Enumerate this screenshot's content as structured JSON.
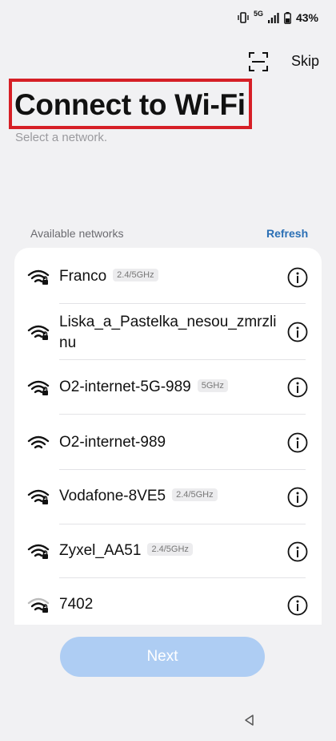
{
  "status_bar": {
    "network_label": "5G",
    "battery": "43%"
  },
  "header": {
    "skip_label": "Skip",
    "scan_icon": "qr-scan-icon",
    "title": "Connect to Wi-Fi",
    "subtitle": "Select a network."
  },
  "networks_section": {
    "label": "Available networks",
    "refresh_label": "Refresh",
    "items": [
      {
        "name": "Franco",
        "band": "2.4/5GHz",
        "secured": true
      },
      {
        "name": "Liska_a_Pastelka_nesou_zmrzlinu",
        "name_line1": "Liska_a_Pastelka_nesou_zmrzli",
        "name_line2": "nu",
        "band": "",
        "secured": true
      },
      {
        "name": "O2-internet-5G-989",
        "band": "5GHz",
        "secured": true
      },
      {
        "name": "O2-internet-989",
        "band": "",
        "secured": false
      },
      {
        "name": "Vodafone-8VE5",
        "band": "2.4/5GHz",
        "secured": true
      },
      {
        "name": "Zyxel_AA51",
        "band": "2.4/5GHz",
        "secured": true
      },
      {
        "name": "7402",
        "band": "",
        "secured": true
      }
    ]
  },
  "footer": {
    "next_label": "Next"
  },
  "colors": {
    "background": "#f1f1f3",
    "accent_link": "#2a6fb5",
    "next_disabled": "#aecdf3",
    "highlight_box": "#d61f26"
  }
}
